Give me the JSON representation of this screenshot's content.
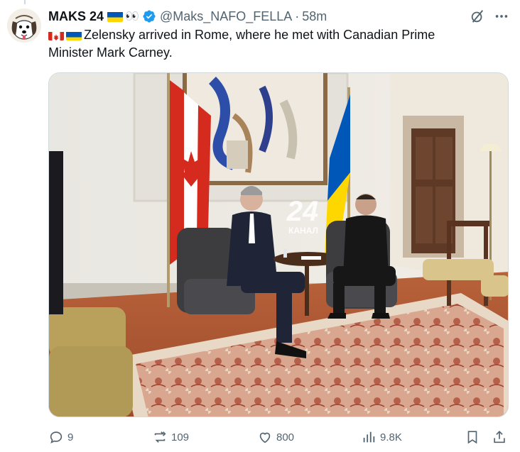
{
  "author": {
    "display_name": "MAKS 24",
    "handle": "@Maks_NAFO_FELLA",
    "separator": "·",
    "timestamp": "58m",
    "eyes": "👀"
  },
  "tweet": {
    "text": "Zelensky arrived in Rome, where he met with Canadian Prime Minister Mark Carney."
  },
  "media": {
    "watermark_number": "24",
    "watermark_label": "КАНАЛ"
  },
  "actions": {
    "replies": "9",
    "reposts": "109",
    "likes": "800",
    "views": "9.8K"
  },
  "colors": {
    "text": "#0f1419",
    "secondary": "#536471",
    "verified_blue": "#1d9bf0",
    "canada_red": "#d52b1e",
    "ukraine_blue": "#0057b7",
    "ukraine_yellow": "#ffd700"
  },
  "icons": [
    "grok-icon",
    "more-icon",
    "verified-badge-icon",
    "reply-icon",
    "repost-icon",
    "like-icon",
    "views-icon",
    "bookmark-icon",
    "share-icon"
  ]
}
